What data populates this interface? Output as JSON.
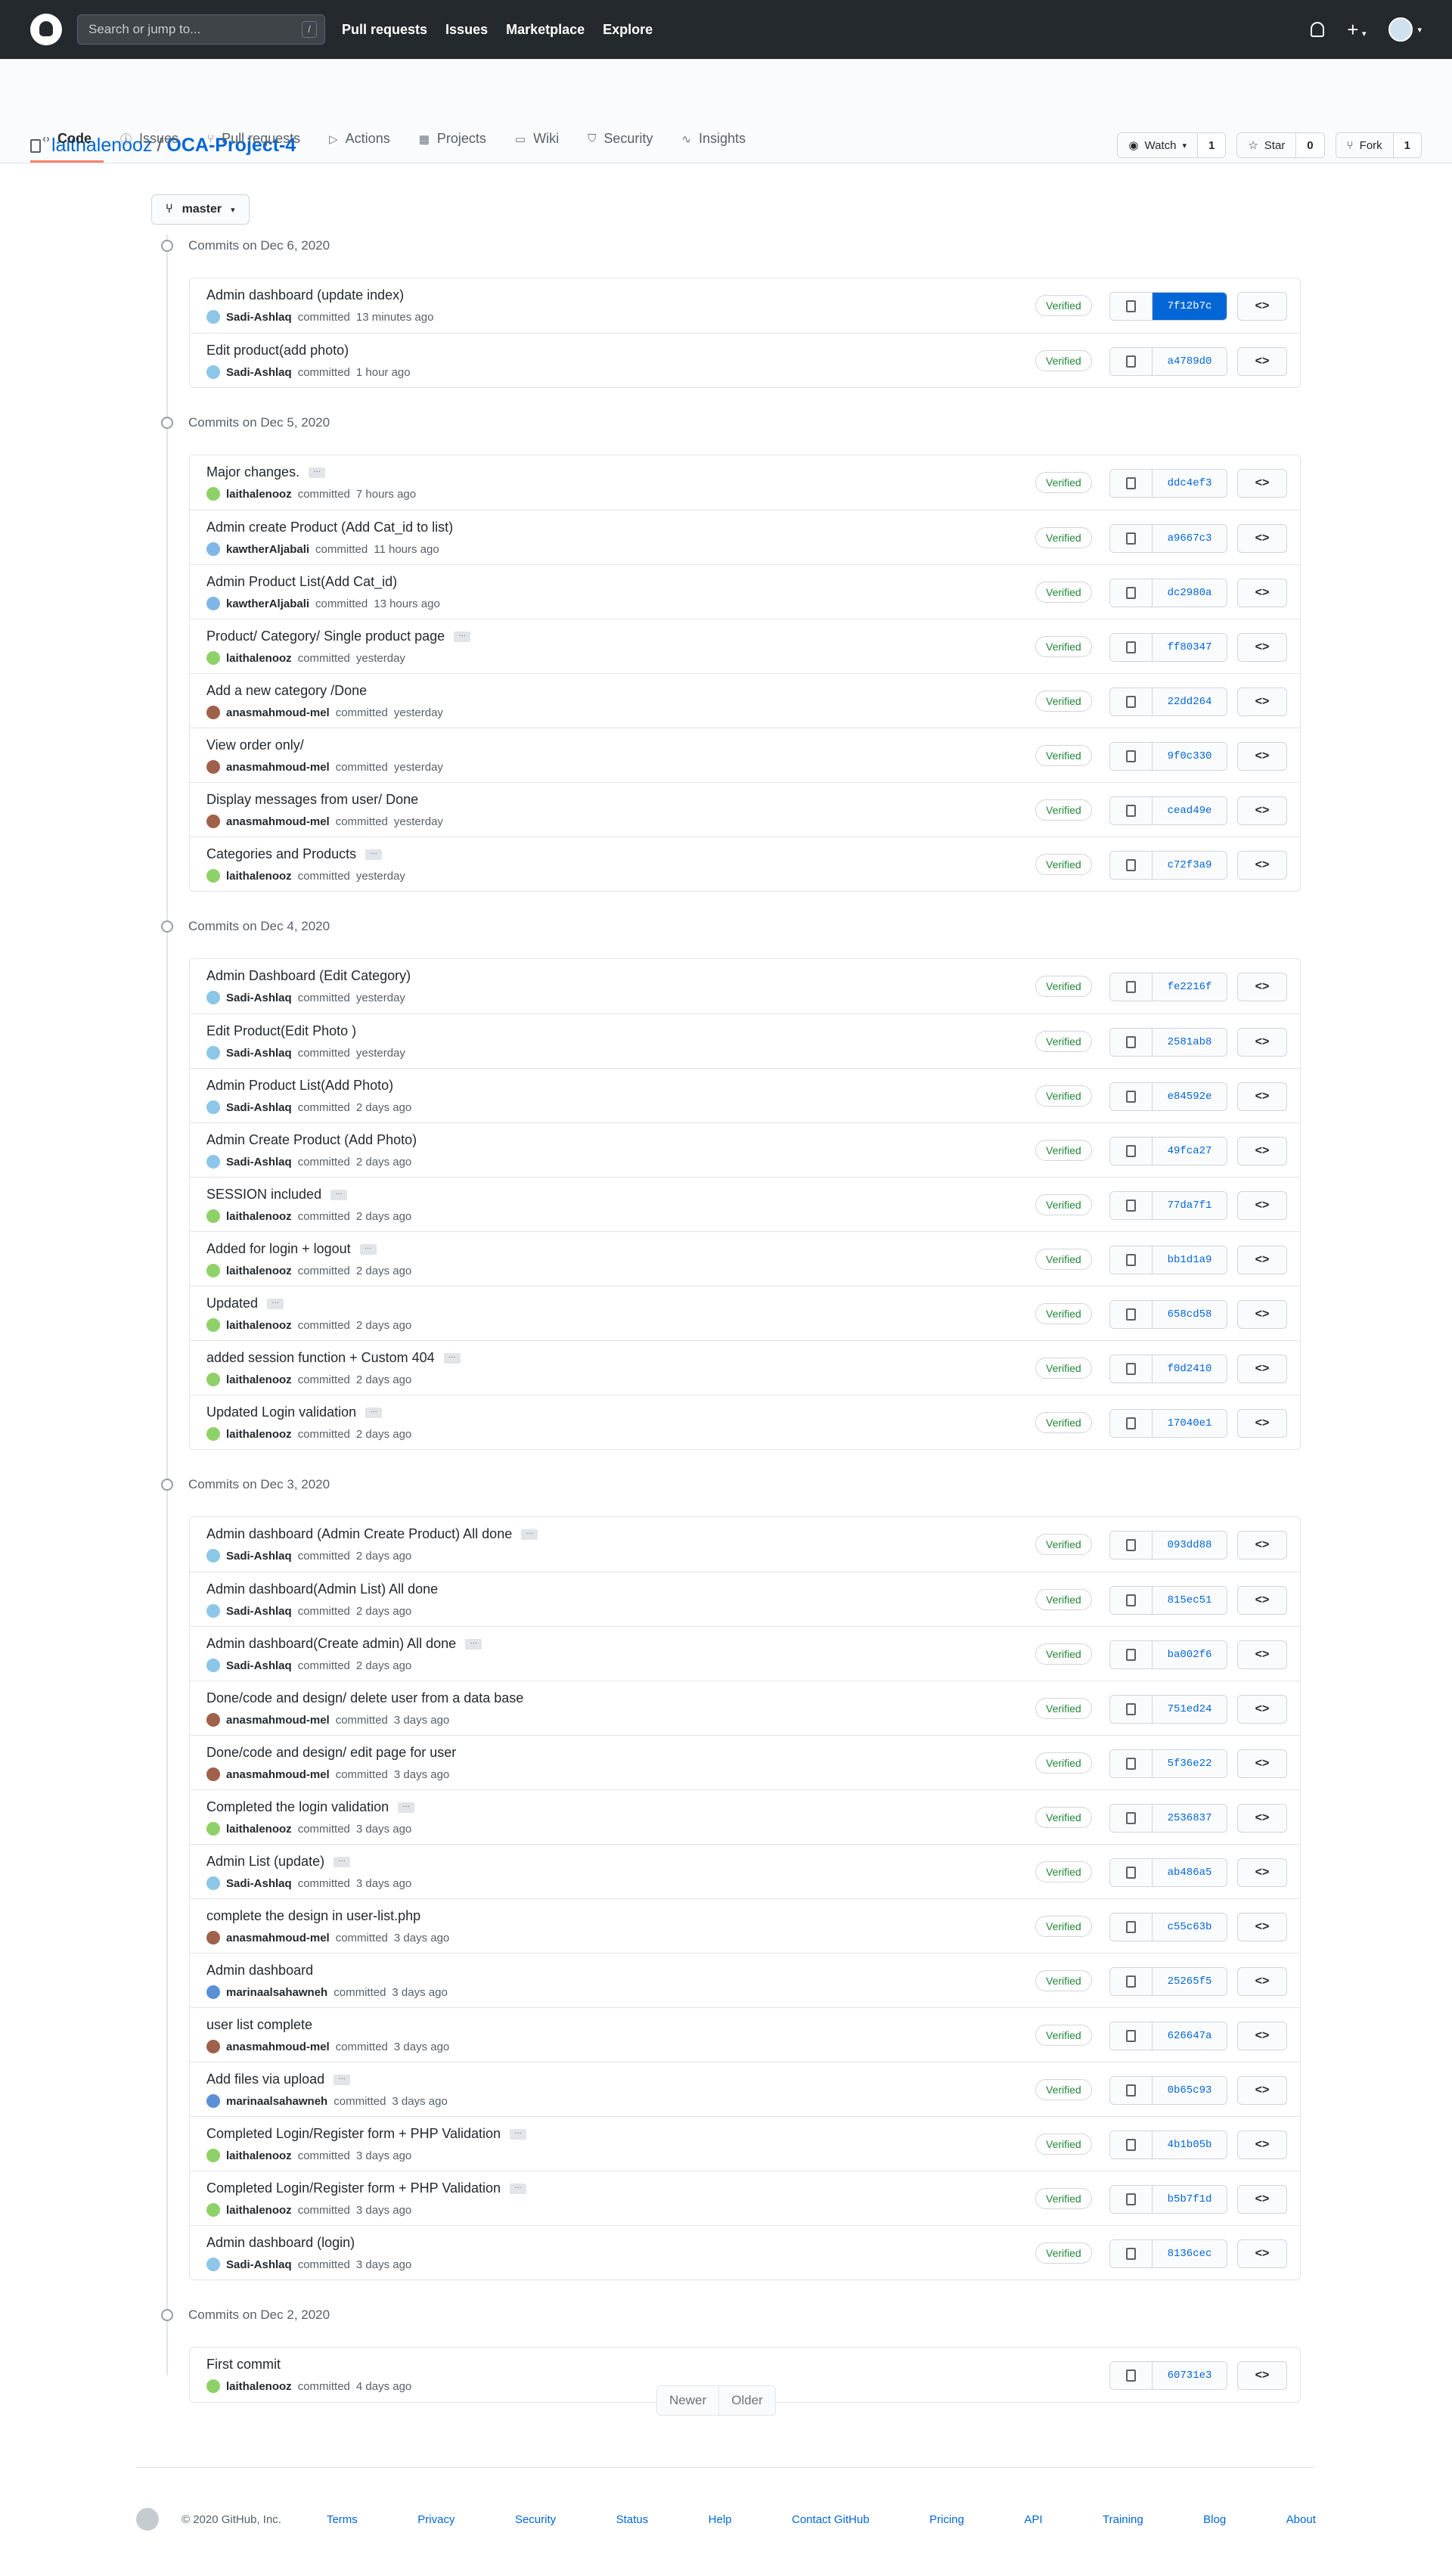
{
  "header": {
    "search_placeholder": "Search or jump to...",
    "slash_key": "/",
    "nav": [
      "Pull requests",
      "Issues",
      "Marketplace",
      "Explore"
    ],
    "plus_icon": "+"
  },
  "repo": {
    "owner": "laithalenooz",
    "separator": "/",
    "name": "OCA-Project-4",
    "watch_label": "Watch",
    "watch_count": "1",
    "star_label": "Star",
    "star_count": "0",
    "fork_label": "Fork",
    "fork_count": "1"
  },
  "tabs": [
    {
      "label": "Code",
      "icon": "‹›"
    },
    {
      "label": "Issues",
      "icon": "ⓘ"
    },
    {
      "label": "Pull requests",
      "icon": "⑂"
    },
    {
      "label": "Actions",
      "icon": "▷"
    },
    {
      "label": "Projects",
      "icon": "▦"
    },
    {
      "label": "Wiki",
      "icon": "▭"
    },
    {
      "label": "Security",
      "icon": "⛉"
    },
    {
      "label": "Insights",
      "icon": "∿"
    }
  ],
  "branch": "master",
  "colors": {
    "accent": "#0366d6",
    "verified": "#22863a",
    "header_bg": "#24292e"
  },
  "verb": "committed",
  "verified_label": "Verified",
  "browse_icon": "<>",
  "groups": [
    {
      "date": "Commits on Dec 6, 2020",
      "commits": [
        {
          "msg": "Admin dashboard (update index)",
          "more": false,
          "author": "Sadi-Ashlaq",
          "time": "13 minutes ago",
          "sha": "7f12b7c",
          "verified": true,
          "hl": true
        },
        {
          "msg": "Edit product(add photo)",
          "more": false,
          "author": "Sadi-Ashlaq",
          "time": "1 hour ago",
          "sha": "a4789d0",
          "verified": true
        }
      ]
    },
    {
      "date": "Commits on Dec 5, 2020",
      "commits": [
        {
          "msg": "Major changes.",
          "more": true,
          "author": "laithalenooz",
          "time": "7 hours ago",
          "sha": "ddc4ef3",
          "verified": true
        },
        {
          "msg": "Admin create Product (Add Cat_id to list)",
          "more": false,
          "author": "kawtherAljabali",
          "time": "11 hours ago",
          "sha": "a9667c3",
          "verified": true
        },
        {
          "msg": "Admin Product List(Add Cat_id)",
          "more": false,
          "author": "kawtherAljabali",
          "time": "13 hours ago",
          "sha": "dc2980a",
          "verified": true
        },
        {
          "msg": "Product/ Category/ Single product page",
          "more": true,
          "author": "laithalenooz",
          "time": "yesterday",
          "sha": "ff80347",
          "verified": true
        },
        {
          "msg": "Add a new category /Done",
          "more": false,
          "author": "anasmahmoud-mel",
          "time": "yesterday",
          "sha": "22dd264",
          "verified": true
        },
        {
          "msg": "View order only/",
          "more": false,
          "author": "anasmahmoud-mel",
          "time": "yesterday",
          "sha": "9f0c330",
          "verified": true
        },
        {
          "msg": "Display messages from user/ Done",
          "more": false,
          "author": "anasmahmoud-mel",
          "time": "yesterday",
          "sha": "cead49e",
          "verified": true
        },
        {
          "msg": "Categories and Products",
          "more": true,
          "author": "laithalenooz",
          "time": "yesterday",
          "sha": "c72f3a9",
          "verified": true
        }
      ]
    },
    {
      "date": "Commits on Dec 4, 2020",
      "commits": [
        {
          "msg": "Admin Dashboard (Edit Category)",
          "more": false,
          "author": "Sadi-Ashlaq",
          "time": "yesterday",
          "sha": "fe2216f",
          "verified": true
        },
        {
          "msg": "Edit Product(Edit Photo )",
          "more": false,
          "author": "Sadi-Ashlaq",
          "time": "yesterday",
          "sha": "2581ab8",
          "verified": true
        },
        {
          "msg": "Admin Product List(Add Photo)",
          "more": false,
          "author": "Sadi-Ashlaq",
          "time": "2 days ago",
          "sha": "e84592e",
          "verified": true
        },
        {
          "msg": "Admin Create Product (Add Photo)",
          "more": false,
          "author": "Sadi-Ashlaq",
          "time": "2 days ago",
          "sha": "49fca27",
          "verified": true
        },
        {
          "msg": "SESSION included",
          "more": true,
          "author": "laithalenooz",
          "time": "2 days ago",
          "sha": "77da7f1",
          "verified": true
        },
        {
          "msg": "Added for login + logout",
          "more": true,
          "author": "laithalenooz",
          "time": "2 days ago",
          "sha": "bb1d1a9",
          "verified": true
        },
        {
          "msg": "Updated",
          "more": true,
          "author": "laithalenooz",
          "time": "2 days ago",
          "sha": "658cd58",
          "verified": true
        },
        {
          "msg": "added session function + Custom 404",
          "more": true,
          "author": "laithalenooz",
          "time": "2 days ago",
          "sha": "f0d2410",
          "verified": true
        },
        {
          "msg": "Updated Login validation",
          "more": true,
          "author": "laithalenooz",
          "time": "2 days ago",
          "sha": "17040e1",
          "verified": true
        }
      ]
    },
    {
      "date": "Commits on Dec 3, 2020",
      "commits": [
        {
          "msg": "Admin dashboard (Admin Create Product) All done",
          "more": true,
          "author": "Sadi-Ashlaq",
          "time": "2 days ago",
          "sha": "093dd88",
          "verified": true
        },
        {
          "msg": "Admin dashboard(Admin List) All done",
          "more": false,
          "author": "Sadi-Ashlaq",
          "time": "2 days ago",
          "sha": "815ec51",
          "verified": true
        },
        {
          "msg": "Admin dashboard(Create admin) All done",
          "more": true,
          "author": "Sadi-Ashlaq",
          "time": "2 days ago",
          "sha": "ba002f6",
          "verified": true
        },
        {
          "msg": "Done/code and design/ delete user from a data base",
          "more": false,
          "author": "anasmahmoud-mel",
          "time": "3 days ago",
          "sha": "751ed24",
          "verified": true
        },
        {
          "msg": "Done/code and design/ edit page for user",
          "more": false,
          "author": "anasmahmoud-mel",
          "time": "3 days ago",
          "sha": "5f36e22",
          "verified": true
        },
        {
          "msg": "Completed the login validation",
          "more": true,
          "author": "laithalenooz",
          "time": "3 days ago",
          "sha": "2536837",
          "verified": true
        },
        {
          "msg": "Admin List (update)",
          "more": true,
          "author": "Sadi-Ashlaq",
          "time": "3 days ago",
          "sha": "ab486a5",
          "verified": true
        },
        {
          "msg": "complete the design in user-list.php",
          "more": false,
          "author": "anasmahmoud-mel",
          "time": "3 days ago",
          "sha": "c55c63b",
          "verified": true
        },
        {
          "msg": "Admin dashboard",
          "more": false,
          "author": "marinaalsahawneh",
          "time": "3 days ago",
          "sha": "25265f5",
          "verified": true
        },
        {
          "msg": "user list complete",
          "more": false,
          "author": "anasmahmoud-mel",
          "time": "3 days ago",
          "sha": "626647a",
          "verified": true
        },
        {
          "msg": "Add files via upload",
          "more": true,
          "author": "marinaalsahawneh",
          "time": "3 days ago",
          "sha": "0b65c93",
          "verified": true
        },
        {
          "msg": "Completed Login/Register form + PHP Validation",
          "more": true,
          "author": "laithalenooz",
          "time": "3 days ago",
          "sha": "4b1b05b",
          "verified": true
        },
        {
          "msg": "Completed Login/Register form + PHP Validation",
          "more": true,
          "author": "laithalenooz",
          "time": "3 days ago",
          "sha": "b5b7f1d",
          "verified": true
        },
        {
          "msg": "Admin dashboard (login)",
          "more": false,
          "author": "Sadi-Ashlaq",
          "time": "3 days ago",
          "sha": "8136cec",
          "verified": true
        }
      ]
    },
    {
      "date": "Commits on Dec 2, 2020",
      "commits": [
        {
          "msg": "First commit",
          "more": false,
          "author": "laithalenooz",
          "time": "4 days ago",
          "sha": "60731e3",
          "verified": false
        }
      ]
    }
  ],
  "avatar_colors": {
    "Sadi-Ashlaq": "#8cc6e8",
    "laithalenooz": "#8fd169",
    "kawtherAljabali": "#7fb6e6",
    "anasmahmoud-mel": "#a0614a",
    "marinaalsahawneh": "#5b8fd6"
  },
  "pagination": {
    "newer": "Newer",
    "older": "Older"
  },
  "footer": {
    "copyright": "© 2020 GitHub, Inc.",
    "links": [
      "Terms",
      "Privacy",
      "Security",
      "Status",
      "Help",
      "Contact GitHub",
      "Pricing",
      "API",
      "Training",
      "Blog",
      "About"
    ]
  }
}
